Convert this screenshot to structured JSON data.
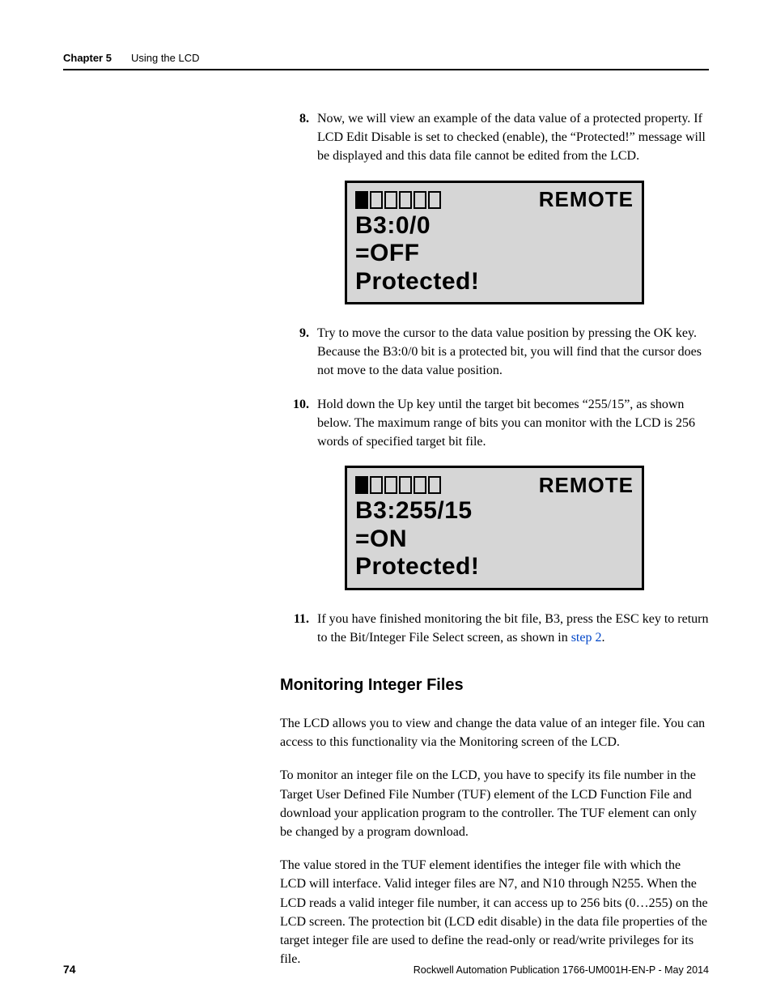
{
  "header": {
    "chapter": "Chapter 5",
    "title": "Using the LCD"
  },
  "steps": [
    {
      "num": "8.",
      "text": "Now, we will view an example of the data value of a protected property. If LCD Edit Disable is set to checked (enable), the “Protected!” message will be displayed and this data file cannot be edited from the LCD."
    },
    {
      "num": "9.",
      "text": "Try to move the cursor to the data value position by pressing the OK key. Because the B3:0/0 bit is a protected bit, you will find that the cursor does not move to the data value position."
    },
    {
      "num": "10.",
      "text": "Hold down the Up key until the target bit becomes “255/15”, as shown below. The maximum range of bits you can monitor with the LCD is 256 words of specified target bit file."
    },
    {
      "num": "11.",
      "text_pre": "If you have finished monitoring the bit file, B3, press the ESC key to return to the Bit/Integer File Select screen, as shown in ",
      "link": "step 2",
      "text_post": "."
    }
  ],
  "lcd1": {
    "remote": "REMOTE",
    "line1": "B3:0/0",
    "line2": "=OFF",
    "line3": "Protected!"
  },
  "lcd2": {
    "remote": "REMOTE",
    "line1": "B3:255/15",
    "line2": "=ON",
    "line3": "Protected!"
  },
  "section": {
    "heading": "Monitoring Integer Files",
    "p1": "The LCD allows you to view and change the data value of an integer file. You can access to this functionality via the Monitoring screen of the LCD.",
    "p2": "To monitor an integer file on the LCD, you have to specify its file number in the Target User Defined File Number (TUF) element of the LCD Function File and download your application program to the controller. The TUF element can only be changed by a program download.",
    "p3": "The value stored in the TUF element identifies the integer file with which the LCD will interface.  Valid integer files are N7, and N10 through N255. When the LCD reads a valid integer file number, it can access up to 256 bits (0…255) on the LCD screen. The protection bit (LCD edit disable) in the data file properties of the target integer file are used to define the read-only or read/write privileges for its file."
  },
  "footer": {
    "page": "74",
    "pub": "Rockwell Automation Publication 1766-UM001H-EN-P - May 2014"
  }
}
